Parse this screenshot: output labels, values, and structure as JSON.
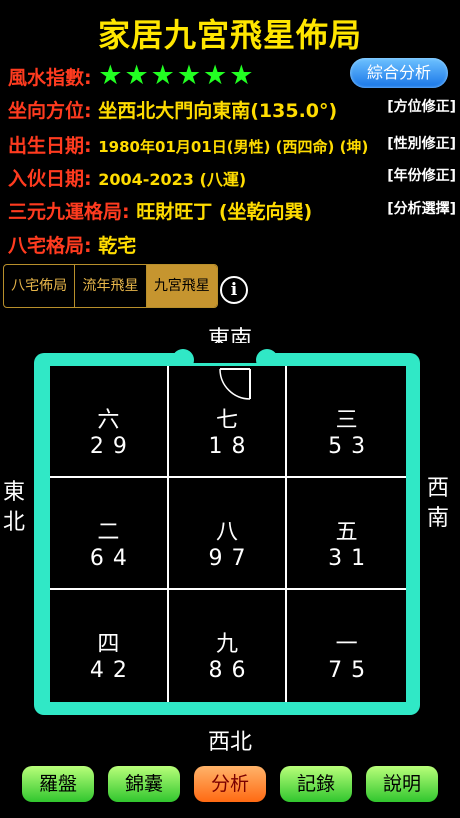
{
  "app": {
    "title": "家居九宮飛星佈局"
  },
  "rows": {
    "fengshui_label": "風水指數:",
    "stars": "★★★★★★",
    "analyze_button": "綜合分析",
    "facing_label": "坐向方位:",
    "facing_value": "坐西北大門向東南(135.0°)",
    "facing_fix": "[方位修正]",
    "birth_label": "出生日期:",
    "birth_value": "1980年01月01日(男性) (西四命) (坤)",
    "birth_fix": "[性別修正]",
    "move_label": "入伙日期:",
    "move_value": "2004-2023 (八運)",
    "move_fix": "[年份修正]",
    "sanyuan_label": "三元九運格局:",
    "sanyuan_value": "旺財旺丁 (坐乾向巽)",
    "sanyuan_fix": "[分析選擇]",
    "bazhai_label": "八宅格局:",
    "bazhai_value": "乾宅"
  },
  "tabs": [
    {
      "label": "八宅佈局",
      "active": false
    },
    {
      "label": "流年飛星",
      "active": false
    },
    {
      "label": "九宮飛星",
      "active": true
    }
  ],
  "info_icon": "i",
  "directions": {
    "top": "東南",
    "bottom": "西北",
    "left": [
      "東",
      "北"
    ],
    "right": [
      "西",
      "南"
    ]
  },
  "cells": [
    {
      "palace": "六",
      "nums": "29"
    },
    {
      "palace": "七",
      "nums": "18"
    },
    {
      "palace": "三",
      "nums": "53"
    },
    {
      "palace": "二",
      "nums": "64"
    },
    {
      "palace": "八",
      "nums": "97"
    },
    {
      "palace": "五",
      "nums": "31"
    },
    {
      "palace": "四",
      "nums": "42"
    },
    {
      "palace": "九",
      "nums": "86"
    },
    {
      "palace": "一",
      "nums": "75"
    }
  ],
  "bottom_buttons": [
    {
      "label": "羅盤",
      "style": "green"
    },
    {
      "label": "錦囊",
      "style": "green"
    },
    {
      "label": "分析",
      "style": "orange"
    },
    {
      "label": "記錄",
      "style": "green"
    },
    {
      "label": "說明",
      "style": "green"
    }
  ],
  "colors": {
    "frame": "#30e8c6",
    "title": "#ffe600",
    "label": "#ff3b1f",
    "value": "#ffdc00",
    "stars": "#22ff22"
  }
}
